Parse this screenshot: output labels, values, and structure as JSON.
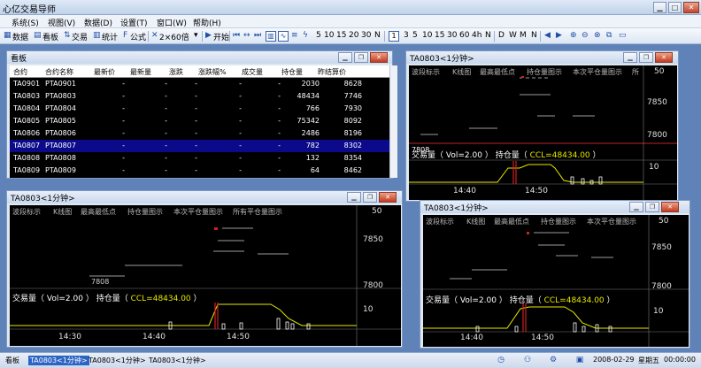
{
  "app": {
    "title": "心亿交易导师"
  },
  "menu": [
    "系统(S)",
    "视图(V)",
    "数据(D)",
    "设置(T)",
    "窗口(W)",
    "帮助(H)"
  ],
  "toolbar": {
    "data": "数据",
    "board": "看板",
    "trade": "交易",
    "stats": "统计",
    "formula": "公式",
    "layout": "2×60倍",
    "start": "开始",
    "periods": [
      "5",
      "10",
      "15",
      "20",
      "30",
      "N"
    ],
    "minutes": [
      "1",
      "3",
      "5",
      "10",
      "15",
      "30",
      "60",
      "4h",
      "N"
    ],
    "dwmn": [
      "D",
      "W",
      "M",
      "N"
    ]
  },
  "board": {
    "title": "看板",
    "columns": [
      "合约",
      "合约名称",
      "最新价",
      "最新量",
      "涨跌",
      "涨跌幅%",
      "成交量",
      "持仓量",
      "昨结算价"
    ],
    "rows": [
      {
        "code": "TA0901",
        "name": "PTA0901",
        "last": "-",
        "lastvol": "-",
        "chg": "-",
        "chgpct": "-",
        "vol": "-",
        "oi": "2030",
        "settle": "8628"
      },
      {
        "code": "TA0803",
        "name": "PTA0803",
        "last": "-",
        "lastvol": "-",
        "chg": "-",
        "chgpct": "-",
        "vol": "-",
        "oi": "48434",
        "settle": "7746"
      },
      {
        "code": "TA0804",
        "name": "PTA0804",
        "last": "-",
        "lastvol": "-",
        "chg": "-",
        "chgpct": "-",
        "vol": "-",
        "oi": "766",
        "settle": "7930"
      },
      {
        "code": "TA0805",
        "name": "PTA0805",
        "last": "-",
        "lastvol": "-",
        "chg": "-",
        "chgpct": "-",
        "vol": "-",
        "oi": "75342",
        "settle": "8092"
      },
      {
        "code": "TA0806",
        "name": "PTA0806",
        "last": "-",
        "lastvol": "-",
        "chg": "-",
        "chgpct": "-",
        "vol": "-",
        "oi": "2486",
        "settle": "8196"
      },
      {
        "code": "TA0807",
        "name": "PTA0807",
        "last": "-",
        "lastvol": "-",
        "chg": "-",
        "chgpct": "-",
        "vol": "-",
        "oi": "782",
        "settle": "8302"
      },
      {
        "code": "TA0808",
        "name": "PTA0808",
        "last": "-",
        "lastvol": "-",
        "chg": "-",
        "chgpct": "-",
        "vol": "-",
        "oi": "132",
        "settle": "8354"
      },
      {
        "code": "TA0809",
        "name": "PTA0809",
        "last": "-",
        "lastvol": "-",
        "chg": "-",
        "chgpct": "-",
        "vol": "-",
        "oi": "64",
        "settle": "8462"
      }
    ],
    "selected_row": 5
  },
  "chart_common": {
    "title": "TA0803<1分钟>",
    "ind_bodong": "波段标示",
    "ind_kline": "K线图",
    "ind_highlow": "最高最低点",
    "ind_oi": "持仓量图示",
    "ind_close_this": "本次平仓量图示",
    "ind_close_all": "所有平仓量图示",
    "ind_close_all_short": "所",
    "price_top": "50",
    "price_mid": "7850",
    "price_low": "7808",
    "price_bottom": "7800",
    "vol_scale": "10",
    "vol_label": "交易量（",
    "vol_value": "Vol=2.00",
    "vol_close": "）",
    "oi_label": "持仓量（",
    "oi_value": "CCL=48434.00",
    "oi_close": "）",
    "times": [
      "14:30",
      "14:40",
      "14:50"
    ]
  },
  "status": {
    "board": "看板",
    "tabs": [
      "TA0803<1分钟>",
      "TA0803<1分钟>",
      "TA0803<1分钟>"
    ],
    "date": "2008-02-29",
    "weekday": "星期五",
    "time": "00:00:00"
  },
  "colors": {
    "accent": "#2c64c4",
    "candle_up": "#d02020",
    "oi_line": "#e8e800",
    "selected_row": "#0a0a8a"
  }
}
